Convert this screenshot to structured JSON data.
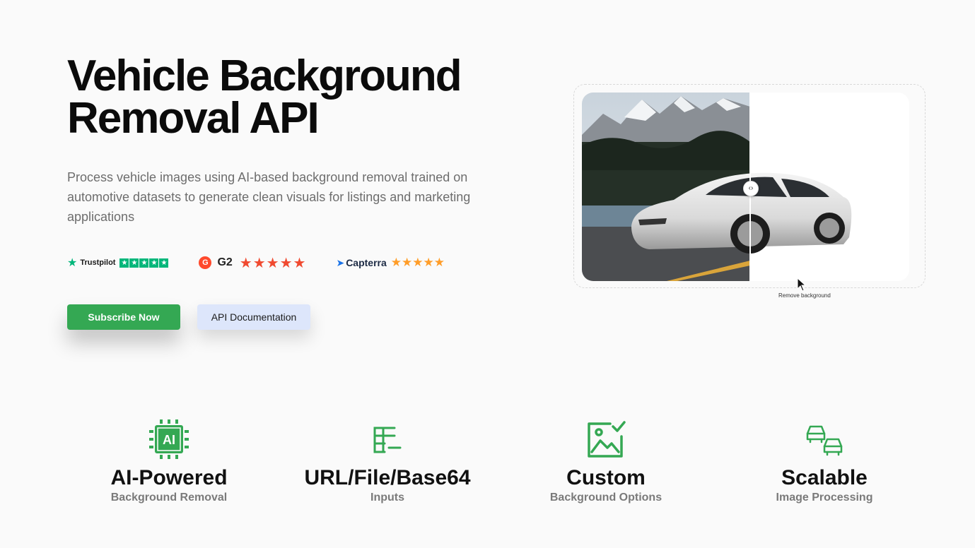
{
  "hero": {
    "title_line1": "Vehicle Background",
    "title_line2": "Removal API",
    "description": "Process vehicle images using AI-based background removal trained on automotive datasets to generate clean visuals for listings and marketing applications"
  },
  "ratings": {
    "trustpilot": {
      "name": "Trustpilot",
      "stars": "★★★★★",
      "rating": 5
    },
    "g2": {
      "name": "G2",
      "logo_letter": "G",
      "stars": "★★★★★",
      "rating": 4.5
    },
    "capterra": {
      "name": "Capterra",
      "stars": "★★★★★",
      "rating": 5
    }
  },
  "buttons": {
    "subscribe": "Subscribe Now",
    "docs": "API Documentation"
  },
  "demo": {
    "handle_glyph": "‹›",
    "caption": "Remove background"
  },
  "features": [
    {
      "icon": "ai-chip-icon",
      "title": "AI-Powered",
      "subtitle": "Background Removal"
    },
    {
      "icon": "table-input-icon",
      "title": "URL/File/Base64",
      "subtitle": "Inputs"
    },
    {
      "icon": "image-check-icon",
      "title": "Custom",
      "subtitle": "Background Options"
    },
    {
      "icon": "cars-icon",
      "title": "Scalable",
      "subtitle": "Image Processing"
    }
  ],
  "colors": {
    "brand_green": "#34a853",
    "trustpilot_green": "#00b67a",
    "g2_red": "#ff492c",
    "capterra_orange": "#ff9d28"
  }
}
